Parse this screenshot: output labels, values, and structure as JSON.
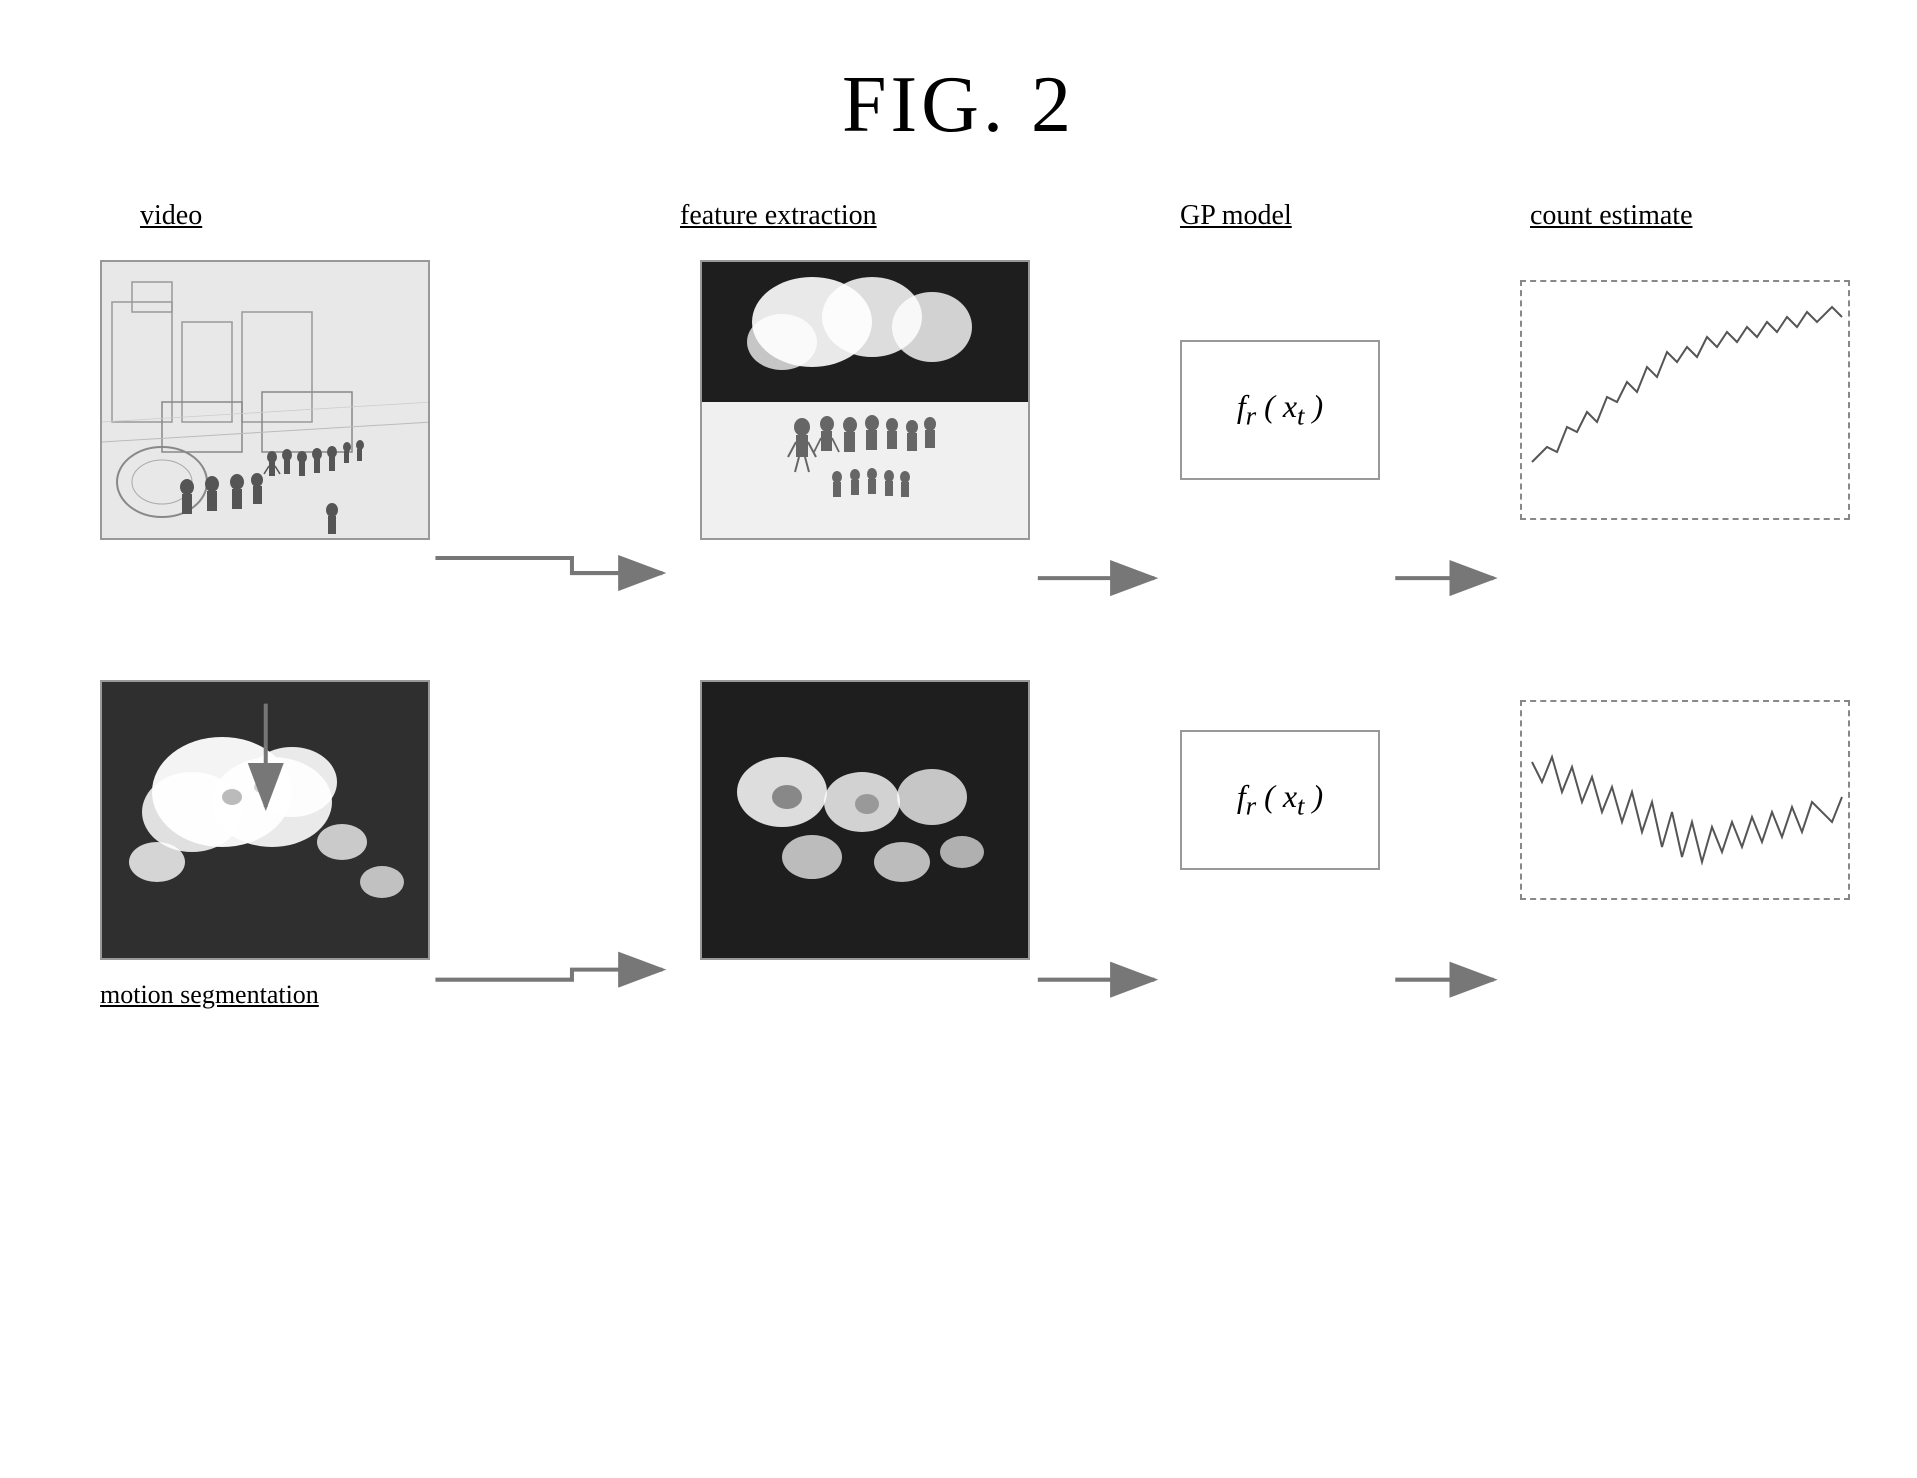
{
  "title": "FIG. 2",
  "labels": {
    "video": "video",
    "feature_extraction": "feature extraction",
    "gp_model": "GP model",
    "count_estimate": "count estimate",
    "motion_segmentation": "motion segmentation"
  },
  "gp_formula_top": "fᵣ ( xₜ )",
  "gp_formula_bottom": "fᵣ ( xₜ )",
  "colors": {
    "background": "#ffffff",
    "dark_box": "#2a2a2a",
    "border": "#999999",
    "border_dashed": "#888888"
  }
}
